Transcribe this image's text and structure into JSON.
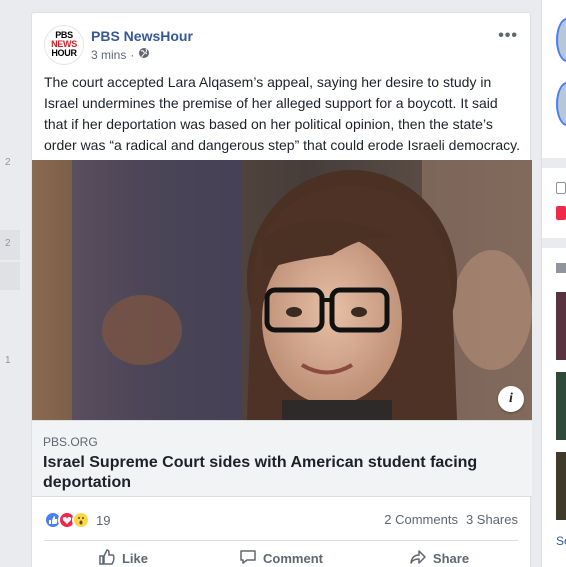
{
  "left_rail": {
    "counts": [
      "2",
      "2",
      "1"
    ]
  },
  "post": {
    "page_name": "PBS NewsHour",
    "logo": {
      "line1": "PBS",
      "line2": "NEWS",
      "line3": "HOUR"
    },
    "time": "3 mins",
    "audience_icon": "globe-icon",
    "more_label": "•••",
    "text": "The court accepted Lara Alqasem’s appeal, saying her desire to study in Israel undermines the premise of her alleged support for a boycott. It said that if her deportation was based on her political opinion, then the state’s order was “a radical and dangerous step” that could erode Israeli democracy.",
    "info_label": "i",
    "link": {
      "domain": "PBS.ORG",
      "title": "Israel Supreme Court sides with American student facing deportation"
    },
    "reactions": {
      "count": "19",
      "types": [
        "like",
        "love",
        "wow"
      ]
    },
    "comments": "2 Comments",
    "shares": "3 Shares",
    "actions": {
      "like": "Like",
      "comment": "Comment",
      "share": "Share"
    }
  },
  "right_rail": {
    "partial_text": "Se"
  },
  "colors": {
    "brand_blue": "#365899",
    "page_bg": "#e9ebee",
    "text": "#1d2129",
    "muted": "#606770"
  }
}
